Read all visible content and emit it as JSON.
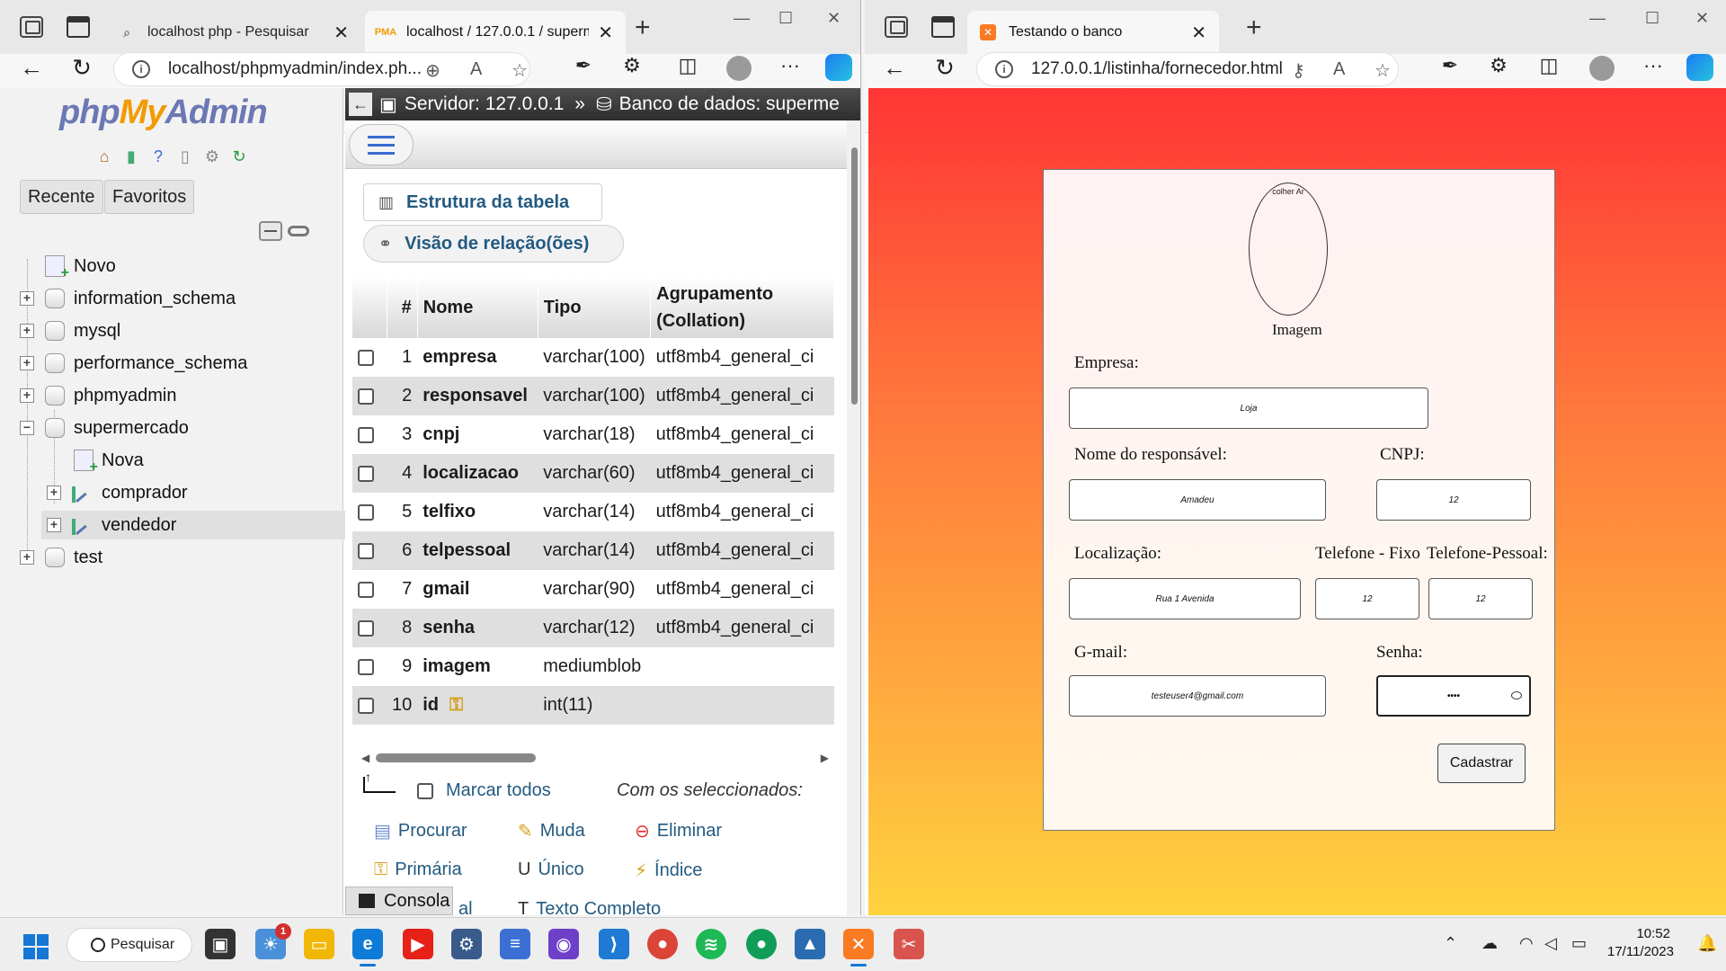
{
  "left_window": {
    "tabs": [
      {
        "title": "localhost php - Pesquisar",
        "active": false
      },
      {
        "title": "localhost / 127.0.0.1 / supermer",
        "active": true
      }
    ],
    "url": "localhost/phpmyadmin/index.ph..."
  },
  "right_window": {
    "tabs": [
      {
        "title": "Testando o banco",
        "active": true
      }
    ],
    "url": "127.0.0.1/listinha/fornecedor.html"
  },
  "pma": {
    "logo": {
      "php": "php",
      "my": "My",
      "admin": "Admin"
    },
    "nav_buttons": {
      "recent": "Recente",
      "favorites": "Favoritos"
    },
    "tree": {
      "new": "Novo",
      "dbs": [
        "information_schema",
        "mysql",
        "performance_schema",
        "phpmyadmin",
        "supermercado"
      ],
      "supermercado_children": {
        "new": "Nova",
        "tables": [
          "comprador",
          "vendedor"
        ]
      },
      "last_db": "test"
    },
    "breadcrumb": {
      "server": "Servidor: 127.0.0.1",
      "sep": "»",
      "db": "Banco de dados: superme"
    },
    "links": {
      "structure": "Estrutura da tabela",
      "relations": "Visão de relação(ões)"
    },
    "table": {
      "headers": {
        "num": "#",
        "name": "Nome",
        "type": "Tipo",
        "collation_1": "Agrupamento",
        "collation_2": "(Collation)"
      },
      "rows": [
        {
          "n": "1",
          "name": "empresa",
          "type": "varchar(100)",
          "coll": "utf8mb4_general_ci"
        },
        {
          "n": "2",
          "name": "responsavel",
          "type": "varchar(100)",
          "coll": "utf8mb4_general_ci"
        },
        {
          "n": "3",
          "name": "cnpj",
          "type": "varchar(18)",
          "coll": "utf8mb4_general_ci"
        },
        {
          "n": "4",
          "name": "localizacao",
          "type": "varchar(60)",
          "coll": "utf8mb4_general_ci"
        },
        {
          "n": "5",
          "name": "telfixo",
          "type": "varchar(14)",
          "coll": "utf8mb4_general_ci"
        },
        {
          "n": "6",
          "name": "telpessoal",
          "type": "varchar(14)",
          "coll": "utf8mb4_general_ci"
        },
        {
          "n": "7",
          "name": "gmail",
          "type": "varchar(90)",
          "coll": "utf8mb4_general_ci"
        },
        {
          "n": "8",
          "name": "senha",
          "type": "varchar(12)",
          "coll": "utf8mb4_general_ci"
        },
        {
          "n": "9",
          "name": "imagem",
          "type": "mediumblob",
          "coll": ""
        },
        {
          "n": "10",
          "name": "id",
          "type": "int(11)",
          "coll": ""
        }
      ]
    },
    "bulk": {
      "check_all": "Marcar todos",
      "with_selected": "Com os seleccionados:",
      "browse": "Procurar",
      "change": "Muda",
      "drop": "Eliminar",
      "primary": "Primária",
      "unique": "Único",
      "index": "Índice",
      "spatial_fragment": "al",
      "fulltext": "Texto Completo"
    },
    "console": "Consola"
  },
  "form": {
    "image_label": "Imagem",
    "image_button_text": "colher Ar",
    "fields": {
      "empresa": {
        "label": "Empresa:",
        "value": "Loja"
      },
      "responsavel": {
        "label": "Nome do responsável:",
        "value": "Amadeu"
      },
      "cnpj": {
        "label": "CNPJ:",
        "value": "12"
      },
      "localizacao": {
        "label": "Localização:",
        "value": "Rua 1 Avenida"
      },
      "telfixo": {
        "label": "Telefone - Fixo",
        "value": "12"
      },
      "telpessoal": {
        "label": "Telefone-Pessoal:",
        "value": "12"
      },
      "gmail": {
        "label": "G-mail:",
        "value": "testeuser4@gmail.com"
      },
      "senha": {
        "label": "Senha:",
        "value": "••••"
      }
    },
    "submit": "Cadastrar"
  },
  "taskbar": {
    "search": "Pesquisar",
    "notification_badge": "1",
    "time": "10:52",
    "date": "17/11/2023"
  }
}
